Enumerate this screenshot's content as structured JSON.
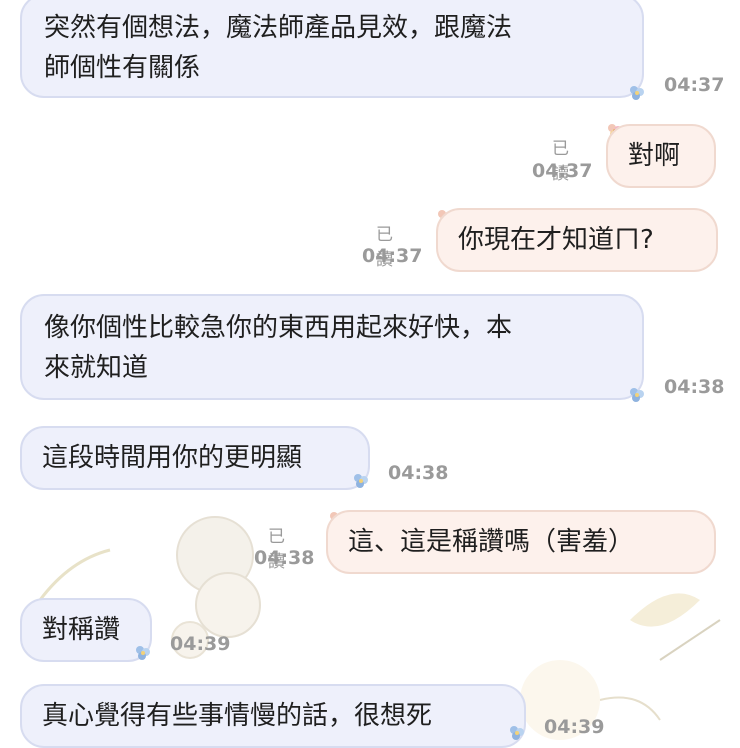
{
  "messages": [
    {
      "side": "in",
      "lines": [
        "突然有個想法，魔法師產品見效，跟魔法",
        "師個性有關係"
      ],
      "time": "04:37"
    },
    {
      "side": "out",
      "lines": [
        "對啊"
      ],
      "read": "已讀",
      "time": "04:37"
    },
    {
      "side": "out",
      "lines": [
        "你現在才知道ㄇ?"
      ],
      "read": "已讀",
      "time": "04:37"
    },
    {
      "side": "in",
      "lines": [
        "像你個性比較急你的東西用起來好快，本",
        "來就知道"
      ],
      "time": "04:38"
    },
    {
      "side": "in",
      "lines": [
        "這段時間用你的更明顯"
      ],
      "time": "04:38"
    },
    {
      "side": "out",
      "lines": [
        "這、這是稱讚嗎（害羞）"
      ],
      "read": "已讀",
      "time": "04:38"
    },
    {
      "side": "in",
      "lines": [
        "對稱讚"
      ],
      "time": "04:39"
    },
    {
      "side": "in",
      "lines": [
        "真心覺得有些事情慢的話，很想死"
      ],
      "time": "04:39"
    }
  ]
}
